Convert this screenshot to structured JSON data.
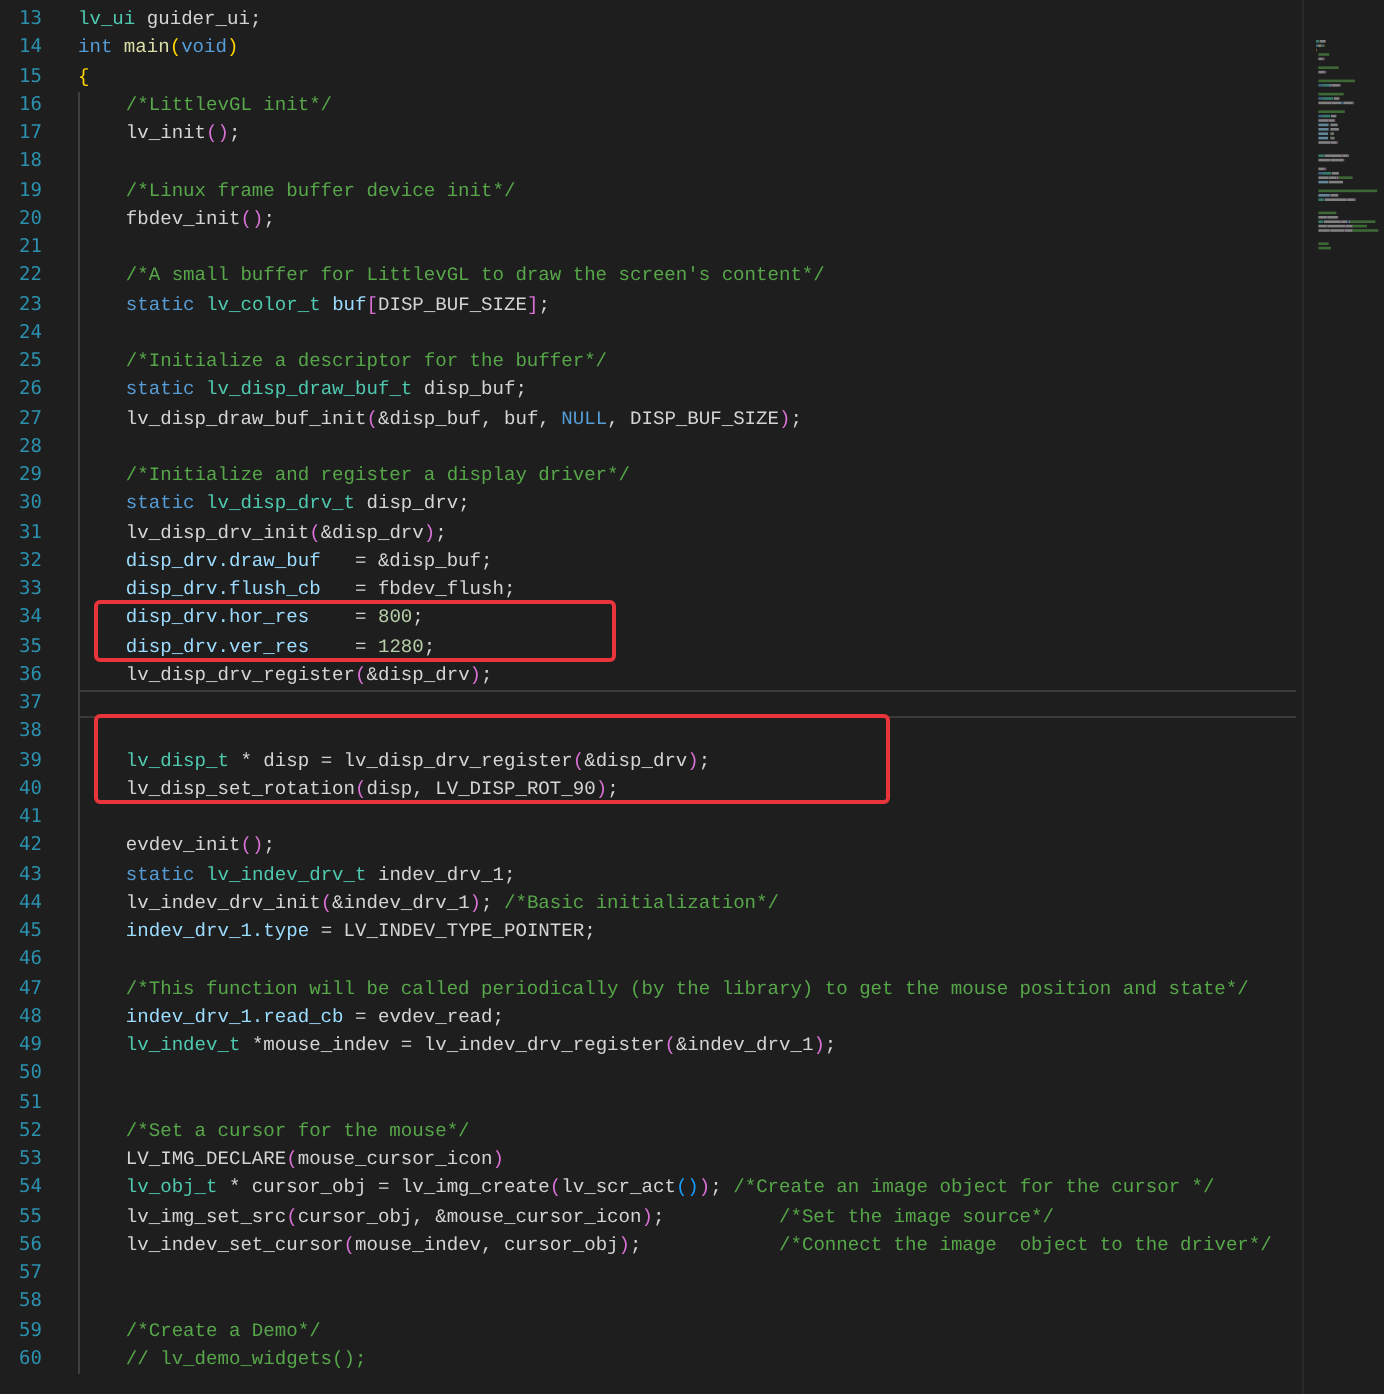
{
  "editor": {
    "lines": [
      {
        "number": "13",
        "current": false,
        "boxed": false,
        "tokens": [
          {
            "kind": "type",
            "text": "lv_ui"
          },
          {
            "kind": "plain",
            "text": " guider_ui;"
          }
        ]
      },
      {
        "number": "14",
        "current": false,
        "boxed": false,
        "tokens": [
          {
            "kind": "keyword",
            "text": "int "
          },
          {
            "kind": "function",
            "text": "main"
          },
          {
            "kind": "bracket1",
            "text": "("
          },
          {
            "kind": "keyword",
            "text": "void"
          },
          {
            "kind": "bracket1",
            "text": ")"
          }
        ]
      },
      {
        "number": "15",
        "current": false,
        "boxed": false,
        "tokens": [
          {
            "kind": "brace",
            "text": "{"
          }
        ]
      },
      {
        "number": "16",
        "current": false,
        "boxed": false,
        "tokens": [
          {
            "kind": "comment",
            "text": "    /*LittlevGL init*/"
          }
        ]
      },
      {
        "number": "17",
        "current": false,
        "boxed": false,
        "tokens": [
          {
            "kind": "plain",
            "text": "    lv_init"
          },
          {
            "kind": "bracket2",
            "text": "()"
          },
          {
            "kind": "plain",
            "text": ";"
          }
        ]
      },
      {
        "number": "18",
        "current": false,
        "boxed": false
      },
      {
        "number": "19",
        "current": false,
        "boxed": false,
        "tokens": [
          {
            "kind": "comment",
            "text": "    /*Linux frame buffer device init*/"
          }
        ]
      },
      {
        "number": "20",
        "current": false,
        "boxed": false,
        "tokens": [
          {
            "kind": "plain",
            "text": "    fbdev_init"
          },
          {
            "kind": "bracket2",
            "text": "()"
          },
          {
            "kind": "plain",
            "text": ";"
          }
        ]
      },
      {
        "number": "21",
        "current": false,
        "boxed": false
      },
      {
        "number": "22",
        "current": false,
        "boxed": false,
        "tokens": [
          {
            "kind": "comment",
            "text": "    /*A small buffer for LittlevGL to draw the screen's content*/"
          }
        ]
      },
      {
        "number": "23",
        "current": false,
        "boxed": false,
        "tokens": [
          {
            "kind": "keyword",
            "text": "    static "
          },
          {
            "kind": "type",
            "text": "lv_color_t "
          },
          {
            "kind": "variable",
            "text": "buf"
          },
          {
            "kind": "bracket2",
            "text": "["
          },
          {
            "kind": "plain",
            "text": "DISP_BUF_SIZE"
          },
          {
            "kind": "bracket2",
            "text": "]"
          },
          {
            "kind": "plain",
            "text": ";"
          }
        ]
      },
      {
        "number": "24",
        "current": false,
        "boxed": false
      },
      {
        "number": "25",
        "current": false,
        "boxed": false,
        "tokens": [
          {
            "kind": "comment",
            "text": "    /*Initialize a descriptor for the buffer*/"
          }
        ]
      },
      {
        "number": "26",
        "current": false,
        "boxed": false,
        "tokens": [
          {
            "kind": "keyword",
            "text": "    static "
          },
          {
            "kind": "type",
            "text": "lv_disp_draw_buf_t"
          },
          {
            "kind": "plain",
            "text": " disp_buf;"
          }
        ]
      },
      {
        "number": "27",
        "current": false,
        "boxed": false,
        "tokens": [
          {
            "kind": "plain",
            "text": "    lv_disp_draw_buf_init"
          },
          {
            "kind": "bracket2",
            "text": "("
          },
          {
            "kind": "plain",
            "text": "&disp_buf, buf, "
          },
          {
            "kind": "keyword",
            "text": "NULL"
          },
          {
            "kind": "plain",
            "text": ", DISP_BUF_SIZE"
          },
          {
            "kind": "bracket2",
            "text": ")"
          },
          {
            "kind": "plain",
            "text": ";"
          }
        ]
      },
      {
        "number": "28",
        "current": false,
        "boxed": false
      },
      {
        "number": "29",
        "current": false,
        "boxed": false,
        "tokens": [
          {
            "kind": "comment",
            "text": "    /*Initialize and register a display driver*/"
          }
        ]
      },
      {
        "number": "30",
        "current": false,
        "boxed": false,
        "tokens": [
          {
            "kind": "keyword",
            "text": "    static "
          },
          {
            "kind": "type",
            "text": "lv_disp_drv_t"
          },
          {
            "kind": "plain",
            "text": " disp_drv;"
          }
        ]
      },
      {
        "number": "31",
        "current": false,
        "boxed": false,
        "tokens": [
          {
            "kind": "plain",
            "text": "    lv_disp_drv_init"
          },
          {
            "kind": "bracket2",
            "text": "("
          },
          {
            "kind": "plain",
            "text": "&disp_drv"
          },
          {
            "kind": "bracket2",
            "text": ")"
          },
          {
            "kind": "plain",
            "text": ";"
          }
        ]
      },
      {
        "number": "32",
        "current": false,
        "boxed": false,
        "tokens": [
          {
            "kind": "variable",
            "text": "    disp_drv.draw_buf"
          },
          {
            "kind": "plain",
            "text": "   = &disp_buf;"
          }
        ]
      },
      {
        "number": "33",
        "current": false,
        "boxed": false,
        "tokens": [
          {
            "kind": "variable",
            "text": "    disp_drv.flush_cb"
          },
          {
            "kind": "plain",
            "text": "   = fbdev_flush;"
          }
        ]
      },
      {
        "number": "34",
        "current": false,
        "boxed": true,
        "tokens": [
          {
            "kind": "variable",
            "text": "    disp_drv.hor_res"
          },
          {
            "kind": "plain",
            "text": "    = "
          },
          {
            "kind": "number",
            "text": "800"
          },
          {
            "kind": "plain",
            "text": ";"
          }
        ]
      },
      {
        "number": "35",
        "current": false,
        "boxed": true,
        "tokens": [
          {
            "kind": "variable",
            "text": "    disp_drv.ver_res"
          },
          {
            "kind": "plain",
            "text": "    = "
          },
          {
            "kind": "number",
            "text": "1280"
          },
          {
            "kind": "plain",
            "text": ";"
          }
        ]
      },
      {
        "number": "36",
        "current": false,
        "boxed": false,
        "tokens": [
          {
            "kind": "plain",
            "text": "    lv_disp_drv_register"
          },
          {
            "kind": "bracket2",
            "text": "("
          },
          {
            "kind": "plain",
            "text": "&disp_drv"
          },
          {
            "kind": "bracket2",
            "text": ")"
          },
          {
            "kind": "plain",
            "text": ";"
          }
        ]
      },
      {
        "number": "37",
        "current": true,
        "boxed": false
      },
      {
        "number": "38",
        "current": false,
        "boxed": true
      },
      {
        "number": "39",
        "current": false,
        "boxed": true,
        "tokens": [
          {
            "kind": "type",
            "text": "    lv_disp_t"
          },
          {
            "kind": "plain",
            "text": " * disp = lv_disp_drv_register"
          },
          {
            "kind": "bracket2",
            "text": "("
          },
          {
            "kind": "plain",
            "text": "&disp_drv"
          },
          {
            "kind": "bracket2",
            "text": ")"
          },
          {
            "kind": "plain",
            "text": ";"
          }
        ]
      },
      {
        "number": "40",
        "current": false,
        "boxed": true,
        "tokens": [
          {
            "kind": "plain",
            "text": "    lv_disp_set_rotation"
          },
          {
            "kind": "bracket2",
            "text": "("
          },
          {
            "kind": "plain",
            "text": "disp, LV_DISP_ROT_90"
          },
          {
            "kind": "bracket2",
            "text": ")"
          },
          {
            "kind": "plain",
            "text": ";"
          }
        ]
      },
      {
        "number": "41",
        "current": false,
        "boxed": false
      },
      {
        "number": "42",
        "current": false,
        "boxed": false,
        "tokens": [
          {
            "kind": "plain",
            "text": "    evdev_init"
          },
          {
            "kind": "bracket2",
            "text": "()"
          },
          {
            "kind": "plain",
            "text": ";"
          }
        ]
      },
      {
        "number": "43",
        "current": false,
        "boxed": false,
        "tokens": [
          {
            "kind": "keyword",
            "text": "    static "
          },
          {
            "kind": "type",
            "text": "lv_indev_drv_t"
          },
          {
            "kind": "plain",
            "text": " indev_drv_1;"
          }
        ]
      },
      {
        "number": "44",
        "current": false,
        "boxed": false,
        "tokens": [
          {
            "kind": "plain",
            "text": "    lv_indev_drv_init"
          },
          {
            "kind": "bracket2",
            "text": "("
          },
          {
            "kind": "plain",
            "text": "&indev_drv_1"
          },
          {
            "kind": "bracket2",
            "text": ")"
          },
          {
            "kind": "plain",
            "text": "; "
          },
          {
            "kind": "comment",
            "text": "/*Basic initialization*/"
          }
        ]
      },
      {
        "number": "45",
        "current": false,
        "boxed": false,
        "tokens": [
          {
            "kind": "variable",
            "text": "    indev_drv_1.type"
          },
          {
            "kind": "plain",
            "text": " = LV_INDEV_TYPE_POINTER;"
          }
        ]
      },
      {
        "number": "46",
        "current": false,
        "boxed": false
      },
      {
        "number": "47",
        "current": false,
        "boxed": false,
        "tokens": [
          {
            "kind": "comment",
            "text": "    /*This function will be called periodically (by the library) to get the mouse position and state*/"
          }
        ]
      },
      {
        "number": "48",
        "current": false,
        "boxed": false,
        "tokens": [
          {
            "kind": "variable",
            "text": "    indev_drv_1.read_cb"
          },
          {
            "kind": "plain",
            "text": " = evdev_read;"
          }
        ]
      },
      {
        "number": "49",
        "current": false,
        "boxed": false,
        "tokens": [
          {
            "kind": "type",
            "text": "    lv_indev_t"
          },
          {
            "kind": "plain",
            "text": " *mouse_indev = lv_indev_drv_register"
          },
          {
            "kind": "bracket2",
            "text": "("
          },
          {
            "kind": "plain",
            "text": "&indev_drv_1"
          },
          {
            "kind": "bracket2",
            "text": ")"
          },
          {
            "kind": "plain",
            "text": ";"
          }
        ]
      },
      {
        "number": "50",
        "current": false,
        "boxed": false
      },
      {
        "number": "51",
        "current": false,
        "boxed": false
      },
      {
        "number": "52",
        "current": false,
        "boxed": false,
        "tokens": [
          {
            "kind": "comment",
            "text": "    /*Set a cursor for the mouse*/"
          }
        ]
      },
      {
        "number": "53",
        "current": false,
        "boxed": false,
        "tokens": [
          {
            "kind": "plain",
            "text": "    LV_IMG_DECLARE"
          },
          {
            "kind": "bracket2",
            "text": "("
          },
          {
            "kind": "plain",
            "text": "mouse_cursor_icon"
          },
          {
            "kind": "bracket2",
            "text": ")"
          }
        ]
      },
      {
        "number": "54",
        "current": false,
        "boxed": false,
        "tokens": [
          {
            "kind": "type",
            "text": "    lv_obj_t"
          },
          {
            "kind": "plain",
            "text": " * cursor_obj = lv_img_create"
          },
          {
            "kind": "bracket2",
            "text": "("
          },
          {
            "kind": "plain",
            "text": "lv_scr_act"
          },
          {
            "kind": "bracket3",
            "text": "()"
          },
          {
            "kind": "bracket2",
            "text": ")"
          },
          {
            "kind": "plain",
            "text": "; "
          },
          {
            "kind": "comment",
            "text": "/*Create an image object for the cursor */"
          }
        ]
      },
      {
        "number": "55",
        "current": false,
        "boxed": false,
        "tokens": [
          {
            "kind": "plain",
            "text": "    lv_img_set_src"
          },
          {
            "kind": "bracket2",
            "text": "("
          },
          {
            "kind": "plain",
            "text": "cursor_obj, &mouse_cursor_icon"
          },
          {
            "kind": "bracket2",
            "text": ")"
          },
          {
            "kind": "plain",
            "text": ";          "
          },
          {
            "kind": "comment",
            "text": "/*Set the image source*/"
          }
        ]
      },
      {
        "number": "56",
        "current": false,
        "boxed": false,
        "tokens": [
          {
            "kind": "plain",
            "text": "    lv_indev_set_cursor"
          },
          {
            "kind": "bracket2",
            "text": "("
          },
          {
            "kind": "plain",
            "text": "mouse_indev, cursor_obj"
          },
          {
            "kind": "bracket2",
            "text": ")"
          },
          {
            "kind": "plain",
            "text": ";            "
          },
          {
            "kind": "comment",
            "text": "/*Connect the image  object to the driver*/"
          }
        ]
      },
      {
        "number": "57",
        "current": false,
        "boxed": false
      },
      {
        "number": "58",
        "current": false,
        "boxed": false
      },
      {
        "number": "59",
        "current": false,
        "boxed": false,
        "tokens": [
          {
            "kind": "comment",
            "text": "    /*Create a Demo*/"
          }
        ]
      },
      {
        "number": "60",
        "current": false,
        "boxed": false,
        "tokens": [
          {
            "kind": "comment",
            "text": "    // lv_demo_widgets();"
          }
        ]
      }
    ]
  }
}
